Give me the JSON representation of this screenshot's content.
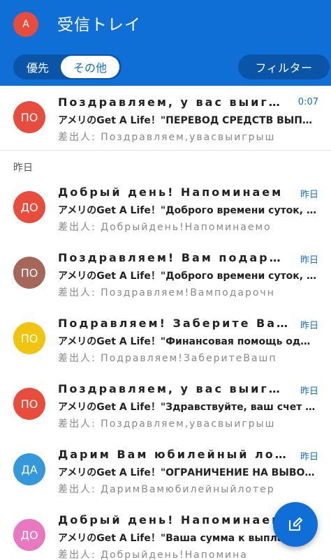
{
  "header": {
    "avatar_initial": "A",
    "avatar_color": "#e74c3c",
    "title": "受信トレイ",
    "tabs": [
      {
        "label": "優先"
      },
      {
        "label": "その他",
        "selected": true
      }
    ],
    "filter_label": "フィルター",
    "accent_color": "#0f6fd6"
  },
  "section_label": "昨日",
  "messages": [
    {
      "initials": "ПО",
      "color": "#e74c3c",
      "sender": "Поздравляем, у вас выигрыш",
      "time": "0:07",
      "subject": "アメリのGet A Life！\"ПЕРЕВОД СРЕДСТВ ВЫПОЛНЕН\"",
      "preview": "差出人: Поздравляем,увасвыигрыш"
    },
    {
      "initials": "ДО",
      "color": "#e74c3c",
      "sender": "Добрый день! Напоминаем",
      "time": "昨日",
      "subject": "アメリのGet A Life！\"Доброго времени суток, в...",
      "preview": "差出人: Добрыйдень!Напоминаемо"
    },
    {
      "initials": "ПО",
      "color": "#a5675a",
      "sender": "Поздравляем! Вам подарок",
      "time": "昨日",
      "subject": "アメリのGet A Life！\"Доброго времени суток, в...",
      "preview": "差出人: Поздравляем!Вамподарочн"
    },
    {
      "initials": "ПО",
      "color": "#f1c40f",
      "sender": "Подравляем! Заберите Ваш",
      "time": "昨日",
      "subject": "アメリのGet A Life！\"Финансовая помощь одоб...",
      "preview": "差出人: Подравляем!ЗаберитеВашп"
    },
    {
      "initials": "ПО",
      "color": "#e74c3c",
      "sender": "Поздравляем, у вас выигрыш",
      "time": "昨日",
      "subject": "アメリのGet A Life！\"Здравствуйте, ваш счет п...",
      "preview": "差出人: Поздравляем,увасвыигрыш"
    },
    {
      "initials": "ДА",
      "color": "#3498db",
      "sender": "Дарим Вам юбилейный лотерейный",
      "time": "昨日",
      "subject": "アメリのGet A Life！\"ОГРАНИЧЕНИЕ НА ВЫВОД...",
      "preview": "差出人: ДаримВамюбилейныйлотер"
    },
    {
      "initials": "ДО",
      "color": "#e879c0",
      "sender": "Добрый день! Напоминаем",
      "time": "",
      "subject": "アメリのGet A Life！\"Ваша сумма к выпла...",
      "preview": "差出人: Добрыйдень!Напомина"
    }
  ],
  "fab_icon": "compose-icon"
}
